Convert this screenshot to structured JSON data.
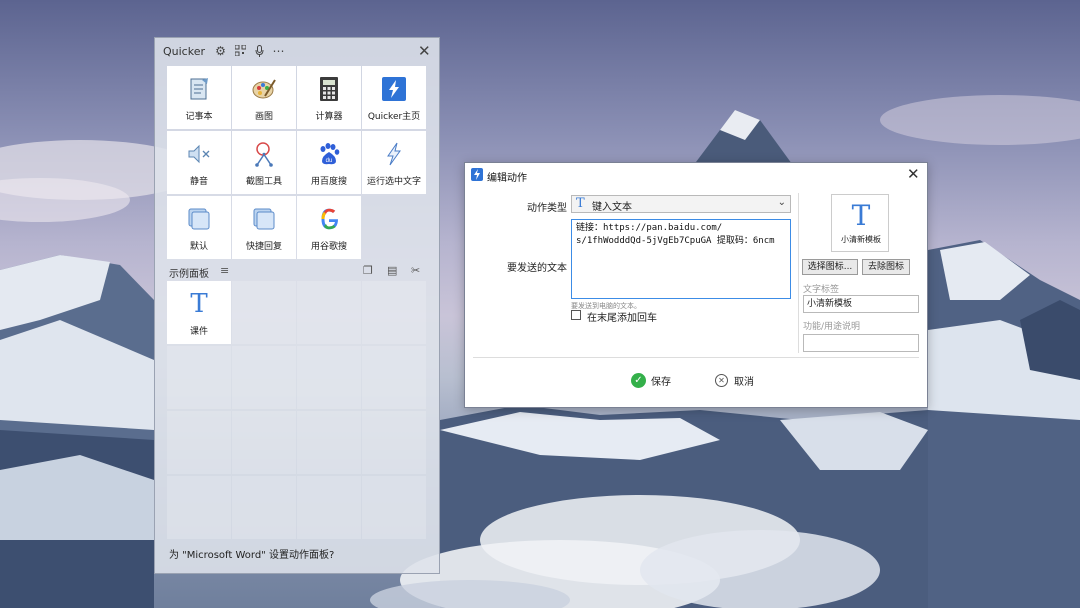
{
  "quicker": {
    "title": "Quicker",
    "header_icons": [
      "gear-icon",
      "qrcode-icon",
      "microphone-icon",
      "more-icon"
    ],
    "tiles": [
      {
        "label": "记事本",
        "icon": "notepad-icon"
      },
      {
        "label": "画图",
        "icon": "paint-palette-icon"
      },
      {
        "label": "计算器",
        "icon": "calculator-icon"
      },
      {
        "label": "Quicker主页",
        "icon": "quicker-lightning-icon"
      },
      {
        "label": "静音",
        "icon": "mute-speaker-icon"
      },
      {
        "label": "截图工具",
        "icon": "scissors-icon"
      },
      {
        "label": "用百度搜",
        "icon": "baidu-paw-icon"
      },
      {
        "label": "运行选中文字",
        "icon": "lightning-outline-icon"
      },
      {
        "label": "默认",
        "icon": "window-stack-icon"
      },
      {
        "label": "快捷回复",
        "icon": "window-stack-icon"
      },
      {
        "label": "用谷歌搜",
        "icon": "google-g-icon"
      }
    ],
    "section_label": "示例面板",
    "section_tiles": [
      {
        "label": "课件",
        "icon": "text-t-icon"
      }
    ],
    "footer_text": "为 \"Microsoft Word\" 设置动作面板?"
  },
  "dialog": {
    "title": "编辑动作",
    "action_type_label": "动作类型",
    "action_type_value": "键入文本",
    "text_label": "要发送的文本",
    "text_value": "链接：https://pan.baidu.com/\ns/1fhWodddQd-5jVgEb7CpuGA 提取码：6ncm",
    "text_hint": "要发送到电脑的文本。",
    "append_enter_label": "在末尾添加回车",
    "preview_icon_letter": "T",
    "preview_label": "小清新模板",
    "choose_icon_button": "选择图标...",
    "remove_icon_button": "去除图标",
    "text_tag_label": "文字标签",
    "text_tag_value": "小清新模板",
    "description_label": "功能/用途说明",
    "description_value": "",
    "save_label": "保存",
    "cancel_label": "取消"
  },
  "colors": {
    "accent_blue": "#3a7bd5",
    "save_green": "#34b04a",
    "textarea_focus": "#3c8ce6"
  }
}
